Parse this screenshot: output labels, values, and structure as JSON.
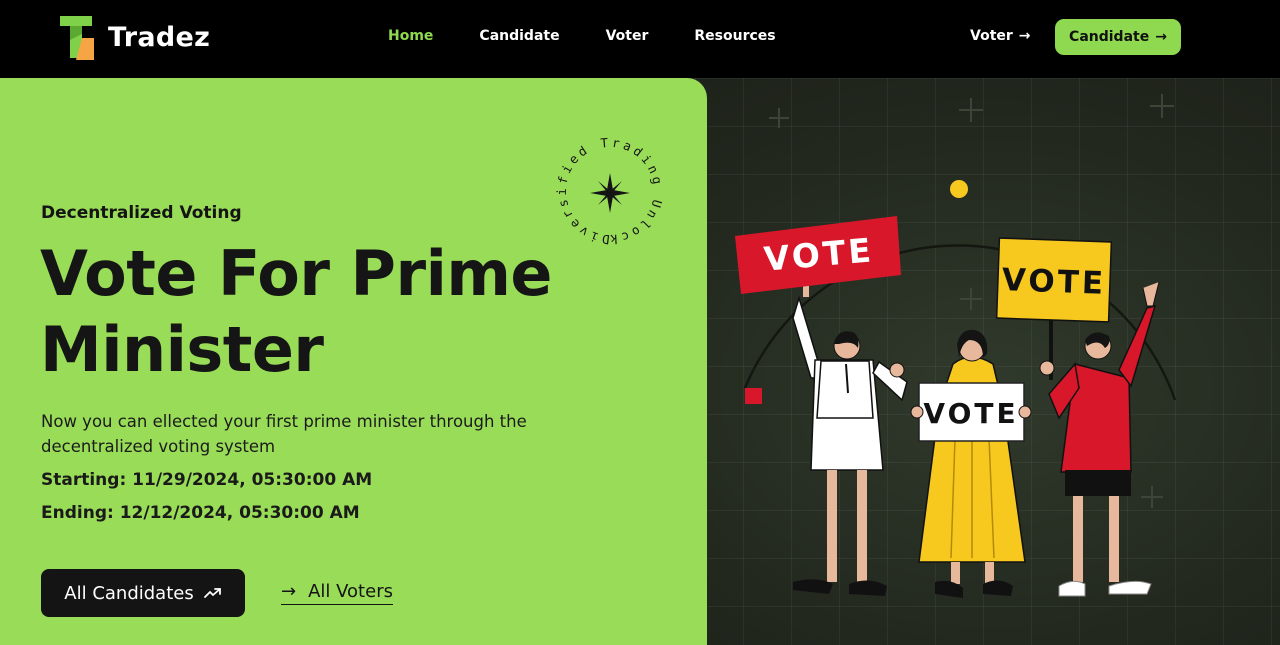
{
  "brand": {
    "name": "Tradez",
    "logo_icon": "tradez-logo-icon",
    "accent": "#8ed94f",
    "logo_orange": "#f5a543"
  },
  "nav": {
    "links": [
      {
        "label": "Home",
        "active": true
      },
      {
        "label": "Candidate",
        "active": false
      },
      {
        "label": "Voter",
        "active": false
      },
      {
        "label": "Resources",
        "active": false
      }
    ],
    "voter_cta": "Voter",
    "candidate_cta": "Candidate"
  },
  "hero": {
    "eyebrow": "Decentralized Voting",
    "headline": "Vote For Prime Minister",
    "description": "Now you can ellected your first prime minister through the decentralized voting system",
    "starting": "Starting: 11/29/2024, 05:30:00 AM",
    "ending": "Ending: 12/12/2024, 05:30:00 AM",
    "primary_button": "All Candidates",
    "secondary_link": "All Voters",
    "badge_text": "Diversified Trading Unlocking "
  },
  "illustration": {
    "signs": [
      "VOTE",
      "VOTE",
      "VOTE"
    ],
    "colors": {
      "red": "#d9172a",
      "yellow": "#f7c81e",
      "green_panel": "#99dc57",
      "dark_bg": "#23291f"
    }
  }
}
